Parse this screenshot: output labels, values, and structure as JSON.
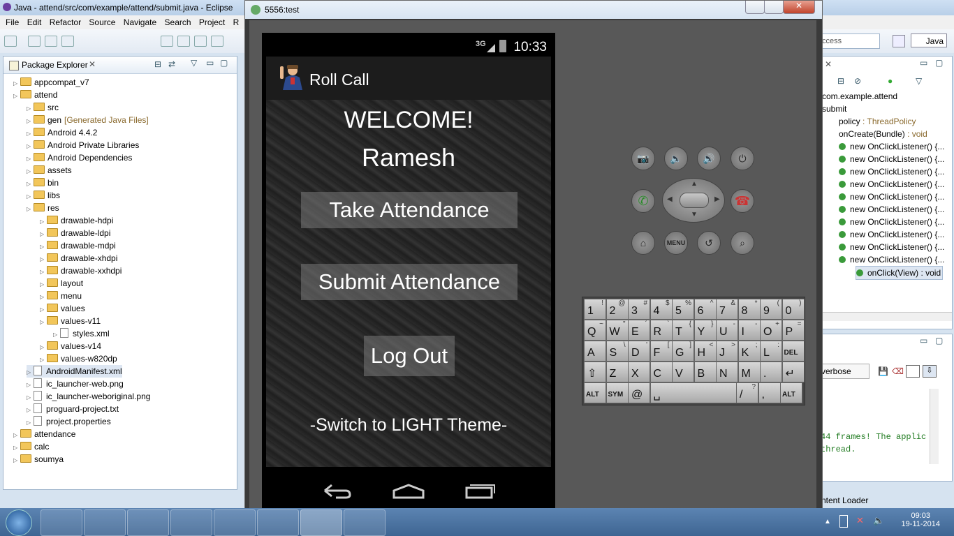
{
  "eclipse": {
    "title": "Java - attend/src/com/example/attend/submit.java - Eclipse",
    "menu": [
      "File",
      "Edit",
      "Refactor",
      "Source",
      "Navigate",
      "Search",
      "Project",
      "R"
    ],
    "quick_access": "ccess",
    "perspective": "Java"
  },
  "package_explorer": {
    "title": "Package Explorer",
    "items": [
      {
        "label": "appcompat_v7",
        "depth": 0
      },
      {
        "label": "attend",
        "depth": 0
      },
      {
        "label": "src",
        "depth": 1
      },
      {
        "label": "gen",
        "extra": "[Generated Java Files]",
        "depth": 1
      },
      {
        "label": "Android 4.4.2",
        "depth": 1
      },
      {
        "label": "Android Private Libraries",
        "depth": 1
      },
      {
        "label": "Android Dependencies",
        "depth": 1
      },
      {
        "label": "assets",
        "depth": 1
      },
      {
        "label": "bin",
        "depth": 1
      },
      {
        "label": "libs",
        "depth": 1
      },
      {
        "label": "res",
        "depth": 1
      },
      {
        "label": "drawable-hdpi",
        "depth": 2
      },
      {
        "label": "drawable-ldpi",
        "depth": 2
      },
      {
        "label": "drawable-mdpi",
        "depth": 2
      },
      {
        "label": "drawable-xhdpi",
        "depth": 2
      },
      {
        "label": "drawable-xxhdpi",
        "depth": 2
      },
      {
        "label": "layout",
        "depth": 2
      },
      {
        "label": "menu",
        "depth": 2
      },
      {
        "label": "values",
        "depth": 2
      },
      {
        "label": "values-v11",
        "depth": 2
      },
      {
        "label": "styles.xml",
        "depth": 3
      },
      {
        "label": "values-v14",
        "depth": 2
      },
      {
        "label": "values-w820dp",
        "depth": 2
      },
      {
        "label": "AndroidManifest.xml",
        "depth": 1
      },
      {
        "label": "ic_launcher-web.png",
        "depth": 1
      },
      {
        "label": "ic_launcher-weboriginal.png",
        "depth": 1
      },
      {
        "label": "proguard-project.txt",
        "depth": 1
      },
      {
        "label": "project.properties",
        "depth": 1
      },
      {
        "label": "attendance",
        "depth": 0
      },
      {
        "label": "calc",
        "depth": 0
      },
      {
        "label": "soumya",
        "depth": 0
      }
    ]
  },
  "outline": {
    "package": "com.example.attend",
    "class": "submit",
    "policy": "policy",
    "policy_type": ": ThreadPolicy",
    "oncreate": "onCreate(Bundle)",
    "oncreate_type": ": void",
    "listener": "new OnClickListener() {...",
    "onclick": "onClick(View) : void"
  },
  "logcat": {
    "level": "verbose",
    "line1": "44 frames!  The applic",
    "line2": "thread.",
    "footer": "ntent Loader"
  },
  "emulator": {
    "window_title": "5556:test",
    "clock": "10:33",
    "signal": "3G",
    "app_title": "Roll Call",
    "welcome": "WELCOME!",
    "user_name": "Ramesh",
    "btn_take": "Take Attendance",
    "btn_submit": "Submit Attendance",
    "btn_logout": "Log Out",
    "theme_switch": "-Switch to LIGHT Theme-",
    "menu_key": "MENU"
  },
  "keyboard": {
    "rows": [
      [
        [
          "1",
          "!"
        ],
        [
          "2",
          "@"
        ],
        [
          "3",
          "#"
        ],
        [
          "4",
          "$"
        ],
        [
          "5",
          "%"
        ],
        [
          "6",
          "^"
        ],
        [
          "7",
          "&"
        ],
        [
          "8",
          "*"
        ],
        [
          "9",
          "("
        ],
        [
          "0",
          ")"
        ]
      ],
      [
        [
          "Q",
          "~"
        ],
        [
          "W",
          "\""
        ],
        [
          "E",
          "´"
        ],
        [
          "R",
          "`"
        ],
        [
          "T",
          "{"
        ],
        [
          "Y",
          "}"
        ],
        [
          "U",
          "-"
        ],
        [
          "I",
          "-"
        ],
        [
          "O",
          "+"
        ],
        [
          "P",
          "="
        ]
      ],
      [
        [
          "A",
          ""
        ],
        [
          "S",
          "\\"
        ],
        [
          "D",
          "'"
        ],
        [
          "F",
          "["
        ],
        [
          "G",
          "]"
        ],
        [
          "H",
          "<"
        ],
        [
          "J",
          ">"
        ],
        [
          "K",
          ";"
        ],
        [
          "L",
          ":"
        ],
        [
          "DEL",
          ""
        ]
      ],
      [
        [
          "⇧",
          ""
        ],
        [
          "Z",
          ""
        ],
        [
          "X",
          ""
        ],
        [
          "C",
          ""
        ],
        [
          "V",
          ""
        ],
        [
          "B",
          ""
        ],
        [
          "N",
          ""
        ],
        [
          "M",
          ""
        ],
        [
          ".",
          ""
        ],
        [
          "↵",
          ""
        ]
      ],
      [
        [
          "ALT",
          ""
        ],
        [
          "SYM",
          ""
        ],
        [
          "@",
          ""
        ],
        [
          "␣",
          ""
        ],
        [
          "/",
          "?"
        ],
        [
          ",",
          ""
        ],
        [
          "ALT",
          ""
        ]
      ]
    ]
  },
  "taskbar": {
    "time": "09:03",
    "date": "19-11-2014"
  }
}
